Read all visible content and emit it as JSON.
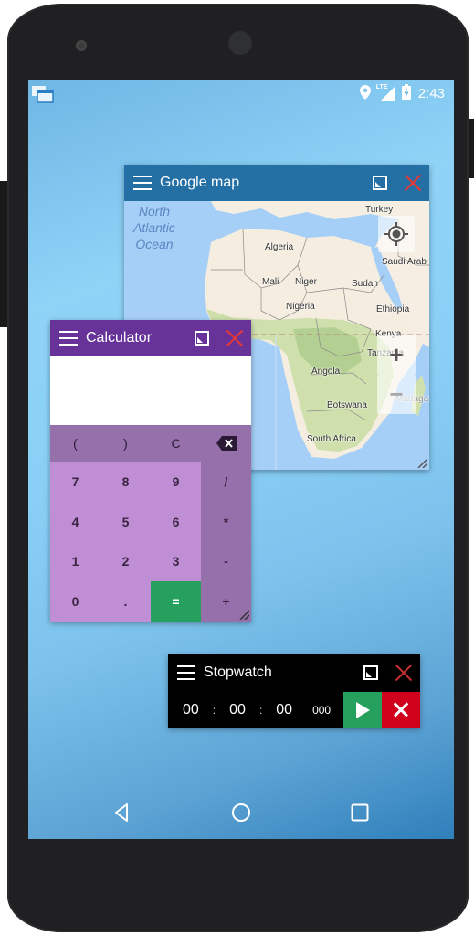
{
  "statusbar": {
    "app_icon": "floating-windows-icon",
    "icons": [
      "location-icon",
      "lte-signal-icon",
      "battery-charging-icon"
    ],
    "network_label": "LTE",
    "time": "2:43"
  },
  "map_window": {
    "title": "Google map",
    "menu_icon": "hamburger-menu-icon",
    "maximize_icon": "maximize-icon",
    "close_icon": "close-icon",
    "ocean_label": [
      "North",
      "Atlantic",
      "Ocean"
    ],
    "place_labels": [
      "Turkey",
      "Algeria",
      "Saudi Arab",
      "Mali",
      "Niger",
      "Sudan",
      "Nigeria",
      "Ethiopia",
      "Kenya",
      "Tanzania",
      "Angola",
      "Botswana",
      "Madagas",
      "South Africa"
    ],
    "controls": {
      "my_location": "crosshair-icon",
      "zoom_in": "+",
      "zoom_out": "−"
    }
  },
  "calculator_window": {
    "title": "Calculator",
    "display_value": "",
    "top_row": [
      "(",
      ")",
      "C",
      "backspace"
    ],
    "keys": [
      "7",
      "8",
      "9",
      "4",
      "5",
      "6",
      "1",
      "2",
      "3",
      "0",
      ".",
      "="
    ],
    "operators": [
      "/",
      "*",
      "-",
      "+"
    ],
    "colors": {
      "titlebar": "#673399",
      "keys": "#bf8ed4",
      "ops": "#9670ab",
      "equals": "#25a05e"
    }
  },
  "stopwatch_window": {
    "title": "Stopwatch",
    "hours": "00",
    "minutes": "00",
    "seconds": "00",
    "milliseconds": "000",
    "separator": ":",
    "play_icon": "play-icon",
    "reset_icon": "close-icon"
  },
  "navbar": {
    "back": "back-icon",
    "home": "home-icon",
    "recents": "recents-icon"
  }
}
